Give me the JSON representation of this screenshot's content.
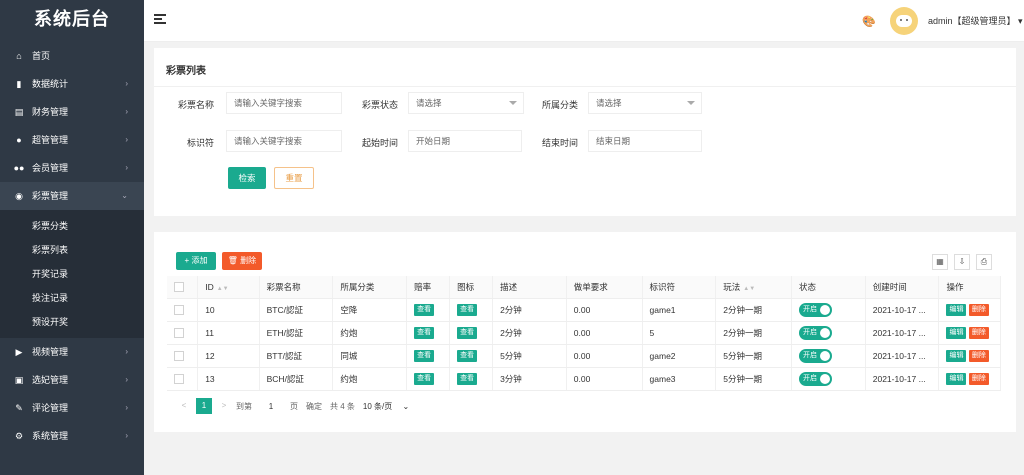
{
  "app": {
    "title": "系统后台"
  },
  "sidebar": {
    "items": [
      {
        "label": "首页",
        "icon": "home-icon",
        "glyph": "⌂",
        "chev": ""
      },
      {
        "label": "数据统计",
        "icon": "bar-chart-icon",
        "glyph": "▮",
        "chev": "›"
      },
      {
        "label": "财务管理",
        "icon": "bank-icon",
        "glyph": "▤",
        "chev": "›"
      },
      {
        "label": "超管管理",
        "icon": "user-icon",
        "glyph": "●",
        "chev": "›"
      },
      {
        "label": "会员管理",
        "icon": "users-icon",
        "glyph": "●●",
        "chev": "›"
      },
      {
        "label": "彩票管理",
        "icon": "gamepad-icon",
        "glyph": "◉",
        "chev": "⌄"
      }
    ],
    "sub_items": [
      "彩票分类",
      "彩票列表",
      "开奖记录",
      "投注记录",
      "预设开奖"
    ],
    "bottom_items": [
      {
        "label": "视频管理",
        "icon": "video-icon",
        "glyph": "▶",
        "chev": "›"
      },
      {
        "label": "选妃管理",
        "icon": "book-icon",
        "glyph": "▣",
        "chev": "›"
      },
      {
        "label": "评论管理",
        "icon": "comment-icon",
        "glyph": "✎",
        "chev": "›"
      },
      {
        "label": "系统管理",
        "icon": "gear-icon",
        "glyph": "⚙",
        "chev": "›"
      }
    ]
  },
  "header": {
    "user": "admin【超级管理员】"
  },
  "filter": {
    "title": "彩票列表",
    "name_label": "彩票名称",
    "name_placeholder": "请输入关键字搜索",
    "status_label": "彩票状态",
    "status_value": "请选择",
    "category_label": "所属分类",
    "category_value": "请选择",
    "code_label": "标识符",
    "code_placeholder": "请输入关键字搜索",
    "start_label": "起始时间",
    "start_placeholder": "开始日期",
    "end_label": "结束时间",
    "end_placeholder": "结束日期",
    "search_btn": "检索",
    "reset_btn": "重置"
  },
  "toolbar": {
    "add": "+ 添加",
    "delete": "🗑 删除"
  },
  "table": {
    "columns": [
      "ID",
      "彩票名称",
      "所属分类",
      "赔率",
      "图标",
      "描述",
      "做单要求",
      "标识符",
      "玩法",
      "状态",
      "创建时间",
      "操作"
    ],
    "view_label": "查看",
    "switch_label": "开启",
    "edit_label": "编辑",
    "delete_label": "删除",
    "rows": [
      {
        "id": "10",
        "name": "BTC/認証",
        "category": "空降",
        "desc": "2分钟",
        "req": "0.00",
        "code": "game1",
        "play": "2分钟一期",
        "created": "2021-10-17 ..."
      },
      {
        "id": "11",
        "name": "ETH/認証",
        "category": "约炮",
        "desc": "2分钟",
        "req": "0.00",
        "code": "5",
        "play": "2分钟一期",
        "created": "2021-10-17 ..."
      },
      {
        "id": "12",
        "name": "BTT/認証",
        "category": "同城",
        "desc": "5分钟",
        "req": "0.00",
        "code": "game2",
        "play": "5分钟一期",
        "created": "2021-10-17 ..."
      },
      {
        "id": "13",
        "name": "BCH/認証",
        "category": "约炮",
        "desc": "3分钟",
        "req": "0.00",
        "code": "game3",
        "play": "5分钟一期",
        "created": "2021-10-17 ..."
      }
    ]
  },
  "pager": {
    "prev": "<",
    "current": "1",
    "next": ">",
    "goto": "到第",
    "page_input": "1",
    "page_unit": "页",
    "confirm": "确定",
    "total": "共 4 条",
    "per_page": "10 条/页"
  }
}
